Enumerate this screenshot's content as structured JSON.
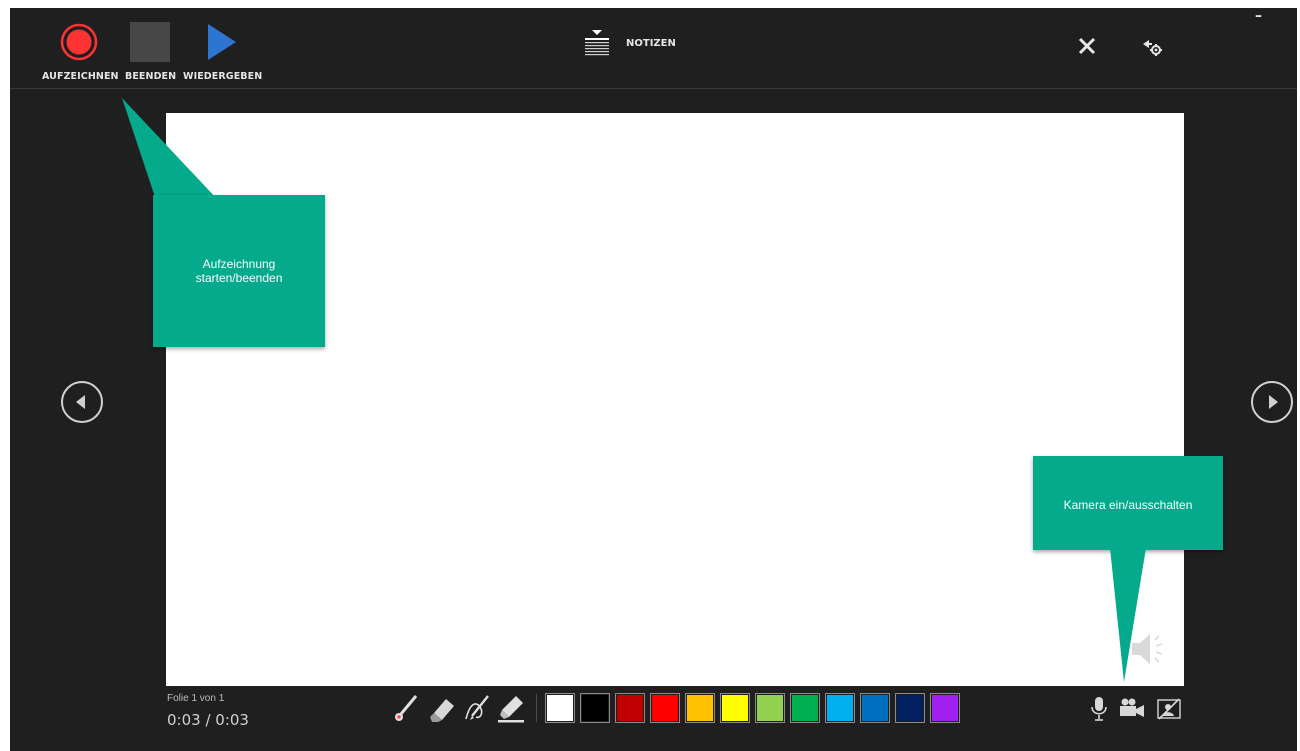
{
  "toolbar": {
    "record_label": "AUFZEICHNEN",
    "stop_label": "BEENDEN",
    "play_label": "WIEDERGEBEN",
    "notes_label": "NOTIZEN",
    "minimize_glyph": "–"
  },
  "callouts": {
    "record_hint": "Aufzeichnung starten/beenden",
    "camera_hint": "Kamera ein/ausschalten"
  },
  "status": {
    "slide_info": "Folie 1 von 1",
    "timer": "0:03 / 0:03"
  },
  "pen_colors": [
    "#ffffff",
    "#000000",
    "#c00000",
    "#ff0000",
    "#ffc000",
    "#ffff00",
    "#92d050",
    "#00b050",
    "#00b0f0",
    "#0070c0",
    "#002060",
    "#a020f0"
  ],
  "icons": {
    "record": "record-icon",
    "stop": "stop-icon",
    "play": "play-icon",
    "notes": "notes-icon",
    "close": "close-icon",
    "settings": "pointer-settings-icon",
    "prev": "previous-slide-icon",
    "next": "next-slide-icon",
    "speaker": "speaker-icon",
    "mic": "microphone-icon",
    "camera": "camera-icon",
    "preview": "camera-preview-icon"
  },
  "colors": {
    "accent_callout": "#05a98b",
    "record_red": "#ff3333",
    "play_blue": "#2e75cf",
    "background": "#1f1f1f"
  }
}
